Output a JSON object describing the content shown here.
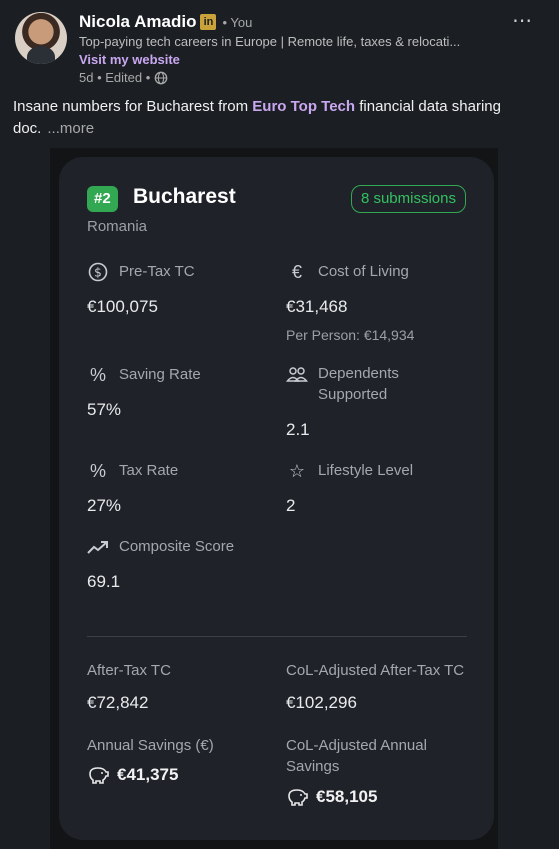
{
  "author": {
    "name": "Nicola Amadio",
    "badge": "in",
    "relation": "• You",
    "headline": "Top-paying tech careers in Europe | Remote life, taxes & relocati...",
    "visit_link": "Visit my website",
    "meta": "5d • Edited •"
  },
  "post": {
    "text_before": "Insane numbers for Bucharest from ",
    "link_text": "Euro Top Tech",
    "text_after": " financial data sharing doc.",
    "more": "...more"
  },
  "card": {
    "rank": "#2",
    "city": "Bucharest",
    "country": "Romania",
    "submissions": "8 submissions",
    "pre_tax": {
      "label": "Pre-Tax TC",
      "value": "€100,075"
    },
    "cost_of_living": {
      "label": "Cost of Living",
      "value": "€31,468",
      "per_person": "Per Person: €14,934"
    },
    "saving_rate": {
      "label": "Saving Rate",
      "value": "57%"
    },
    "dependents": {
      "label": "Dependents Supported",
      "value": "2.1"
    },
    "tax_rate": {
      "label": "Tax Rate",
      "value": "27%"
    },
    "lifestyle": {
      "label": "Lifestyle Level",
      "value": "2"
    },
    "composite": {
      "label": "Composite Score",
      "value": "69.1"
    },
    "after_tax": {
      "label": "After-Tax TC",
      "value": "€72,842"
    },
    "col_after_tax": {
      "label": "CoL-Adjusted After-Tax TC",
      "value": "€102,296"
    },
    "annual_savings": {
      "label": "Annual Savings (€)",
      "value": "€41,375"
    },
    "col_annual_savings": {
      "label": "CoL-Adjusted Annual Savings",
      "value": "€58,105"
    }
  },
  "icons": {
    "pre_tax": "dollar-circle-icon",
    "cost_of_living": "euro-icon",
    "saving_rate": "percent-icon",
    "dependents": "people-icon",
    "tax_rate": "percent-icon",
    "lifestyle": "star-icon",
    "composite": "trend-up-icon",
    "savings": "piggy-bank-icon"
  },
  "colors": {
    "accent_green": "#33a853",
    "link_purple": "#c9a7f0",
    "background": "#1b1f23",
    "card": "#1f2329"
  }
}
